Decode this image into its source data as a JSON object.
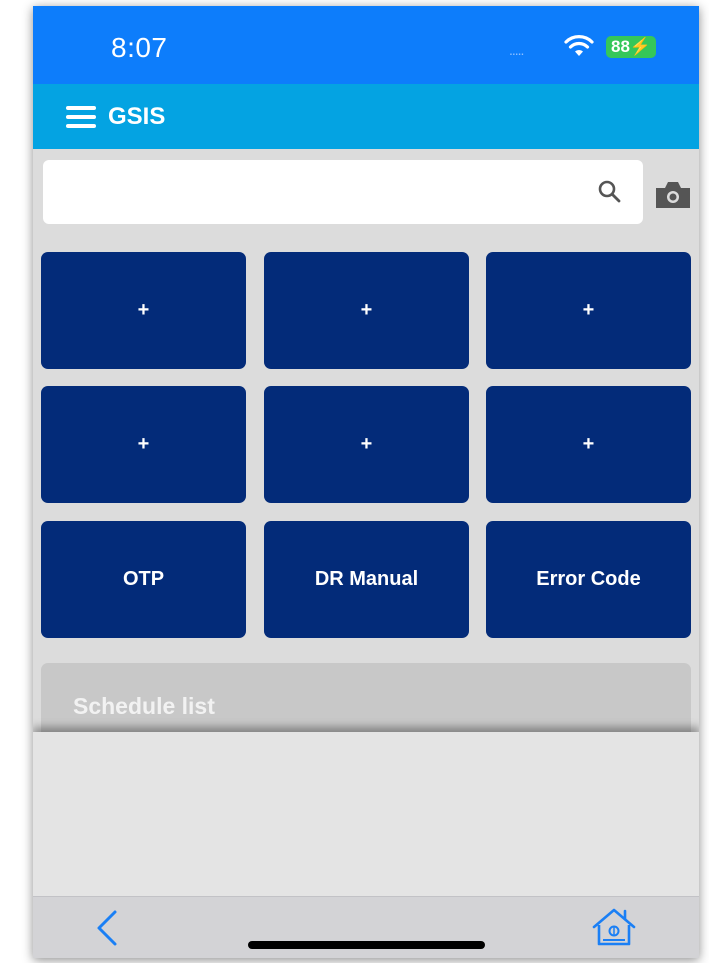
{
  "status_bar": {
    "time": "8:07",
    "signal": ".....",
    "battery": "88"
  },
  "header": {
    "title": "GSIS",
    "menu_icon": "hamburger-menu-icon"
  },
  "search": {
    "value": "",
    "placeholder": "",
    "icon": "search-icon",
    "camera_icon": "camera-icon"
  },
  "tiles": [
    {
      "label": "+"
    },
    {
      "label": "+"
    },
    {
      "label": "+"
    },
    {
      "label": "+"
    },
    {
      "label": "+"
    },
    {
      "label": "+"
    },
    {
      "label": "OTP"
    },
    {
      "label": "DR Manual"
    },
    {
      "label": "Error Code"
    }
  ],
  "schedule": {
    "title": "Schedule list"
  },
  "toolbar": {
    "back_icon": "chevron-left-icon",
    "home_icon": "home-icon"
  },
  "colors": {
    "status_bar": "#0d7dfb",
    "header": "#04a3e2",
    "tile": "#032b79",
    "battery": "#35c759",
    "toolbar_icon": "#1a7ff5"
  }
}
